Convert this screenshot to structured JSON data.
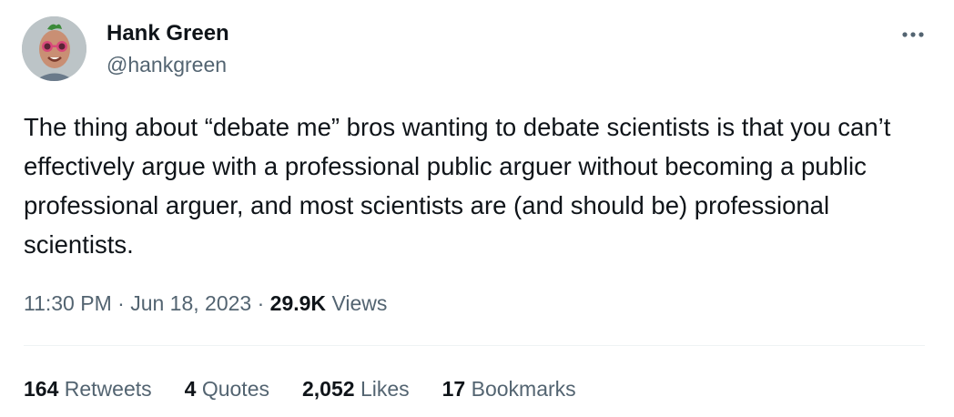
{
  "author": {
    "display_name": "Hank Green",
    "handle": "@hankgreen"
  },
  "tweet": {
    "text": "The thing about “debate me” bros wanting to debate scientists is that you can’t effectively argue with a professional public arguer without becoming a public professional arguer, and most scientists are (and should be) professional scientists."
  },
  "meta": {
    "time": "11:30 PM",
    "separator": "·",
    "date": "Jun 18, 2023",
    "views_count": "29.9K",
    "views_label": "Views"
  },
  "stats": {
    "retweets": {
      "count": "164",
      "label": "Retweets"
    },
    "quotes": {
      "count": "4",
      "label": "Quotes"
    },
    "likes": {
      "count": "2,052",
      "label": "Likes"
    },
    "bookmarks": {
      "count": "17",
      "label": "Bookmarks"
    }
  },
  "icons": {
    "more": "more-options-icon"
  },
  "colors": {
    "text_primary": "#0f1419",
    "text_secondary": "#536471",
    "divider": "#eff3f4"
  }
}
